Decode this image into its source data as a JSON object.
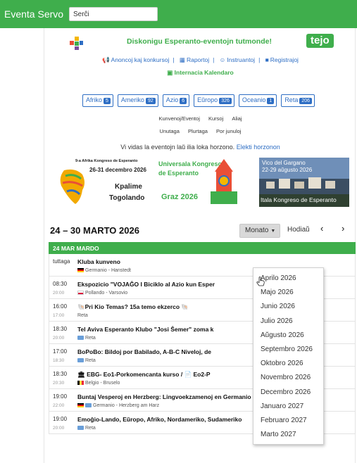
{
  "topbar": {
    "brand": "Eventa Servo",
    "search_value": "Serĉi"
  },
  "header": {
    "tagline": "Diskonigu Esperanto-eventojn tutmonde!",
    "logo_text": "tejo"
  },
  "nav": {
    "links": [
      "Anoncoj kaj konkursoj",
      "Raportoj",
      "Instruantoj",
      "Registrajoj"
    ],
    "calendar": "Internacia Kalendaro"
  },
  "regions": [
    {
      "label": "Afriko",
      "count": "5"
    },
    {
      "label": "Ameriko",
      "count": "92"
    },
    {
      "label": "Azio",
      "count": "6"
    },
    {
      "label": "Eŭropo",
      "count": "326"
    },
    {
      "label": "Oceanio",
      "count": "1"
    },
    {
      "label": "Reta",
      "count": "206"
    }
  ],
  "filters": {
    "row1": [
      "Kunvenoj/Eventoj",
      "Kursoj",
      "Aliaj"
    ],
    "row2": [
      "Unutaga",
      "Plurtaga",
      "Por junuloj"
    ]
  },
  "horizon": {
    "text": "Vi vidas la eventojn laŭ ilia loka horzono.",
    "link": "Elekti horzonon"
  },
  "banners": {
    "b1": {
      "line1": "9-a Afrika Kongreso de Esperanto",
      "line2": "26-31 decembro 2026",
      "city": "Kpalime",
      "country": "Togolando"
    },
    "b2": {
      "line1": "Universala Kongreso",
      "line2": "de Esperanto",
      "city": "Graz",
      "year": "2026"
    },
    "b3": {
      "top1": "Vico del Gargano",
      "top2": "22-29 aŭgusto 2026",
      "bottom": "Itala Kongreso de Esperanto"
    }
  },
  "calendar": {
    "week_title": "24 – 30 MARTO 2026",
    "view_button": "Monato",
    "today_button": "Hodiaŭ",
    "prev": "‹",
    "next": "›",
    "day_header": "24 MAR MARDO",
    "events": [
      {
        "time": "tuttaga",
        "end": "",
        "title": "Kluba kunveno",
        "location": "Germanio - Hanstedt",
        "flag": "de"
      },
      {
        "time": "08:30",
        "end": "20:00",
        "title": "Ekspozicio \"VOJAĜO I Biciklo al Azio kun Esper",
        "location": "Pollando - Varsovio",
        "flag": "pl"
      },
      {
        "time": "16:00",
        "end": "17:00",
        "title": "🐚Pri Kio Temas? 15a temo ekzerco 🐚",
        "location": "Reta",
        "flag": ""
      },
      {
        "time": "18:30",
        "end": "20:00",
        "title": "Tel Aviva Esperanto Klubo \"Josi Ŝemer\" zoma k",
        "location": "Reta",
        "flag": "mon"
      },
      {
        "time": "17:00",
        "end": "18:30",
        "title": "BoPoBo: Bildoj por Babilado, A-B-C Niveloj, de",
        "location": "Reta",
        "flag": "mon"
      },
      {
        "time": "18:30",
        "end": "20:30",
        "title": "🏛 EBG- Eo1-Porkomencanta kurso / 📄 Eo2-P",
        "location": "Belgio - Bruselo",
        "flag": "be"
      },
      {
        "time": "19:00",
        "end": "22:00",
        "title": "Buntaj Vesperoj en Herzberg: Lingvoekzamenoj en Germanio kaj Eŭropo",
        "location": "Germanio - Herzberg am Harz",
        "flag": "de"
      },
      {
        "time": "19:00",
        "end": "20:00",
        "title": "Emoĝio-Lando, Eŭropo, Afriko, Nordameriko, Sudameriko",
        "location": "Reta",
        "flag": "mon"
      }
    ]
  },
  "dropdown": {
    "items": [
      "Aprilo 2026",
      "Majo 2026",
      "Junio 2026",
      "Julio 2026",
      "Aŭgusto 2026",
      "Septembro 2026",
      "Oktobro 2026",
      "Novembro 2026",
      "Decembro 2026",
      "Januaro 2027",
      "Februaro 2027",
      "Marto 2027"
    ]
  },
  "colors": {
    "accent": "#3fae4c",
    "link": "#2e6ec4"
  }
}
